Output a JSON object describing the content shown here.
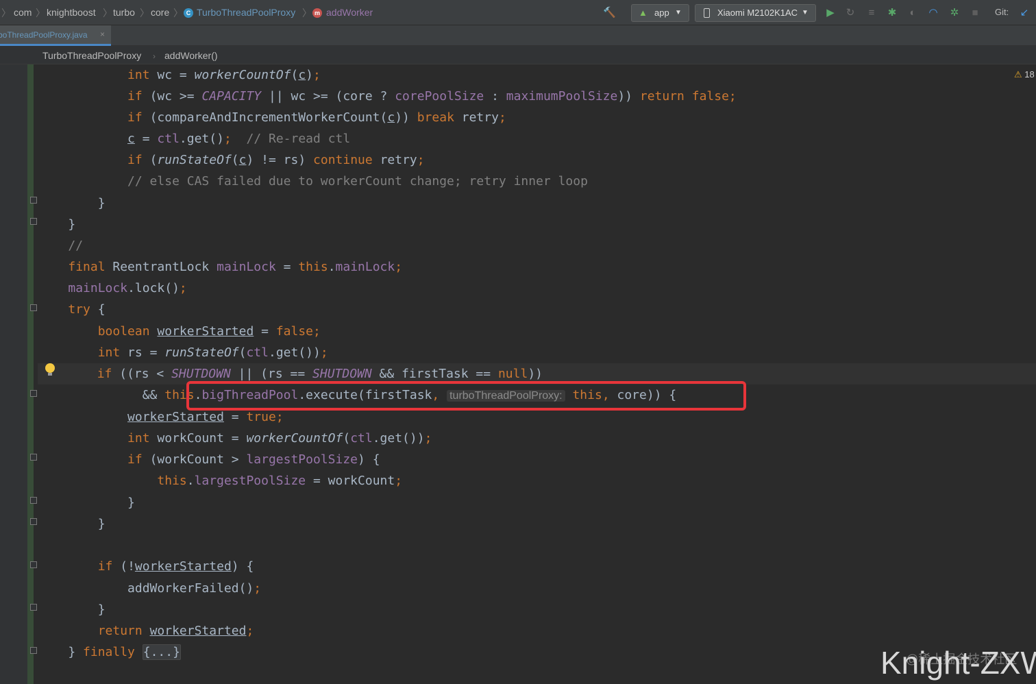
{
  "navbar": {
    "crumbs": [
      "com",
      "knightboost",
      "turbo",
      "core",
      "TurboThreadPoolProxy",
      "addWorker"
    ],
    "run_config": "app",
    "device": "Xiaomi M2102K1AC",
    "git_label": "Git:"
  },
  "tab": {
    "file_name": "boThreadPoolProxy.java",
    "close": "×"
  },
  "breadcrumb": {
    "class_name": "TurboThreadPoolProxy",
    "method_name": "addWorker()"
  },
  "editor": {
    "warning_count": "18",
    "lines": [
      "            int wc = workerCountOf(c);",
      "            if (wc >= CAPACITY || wc >= (core ? corePoolSize : maximumPoolSize)) return false;",
      "            if (compareAndIncrementWorkerCount(c)) break retry;",
      "            c = ctl.get();  // Re-read ctl",
      "            if (runStateOf(c) != rs) continue retry;",
      "            // else CAS failed due to workerCount change; retry inner loop",
      "        }",
      "    }",
      "    //",
      "    final ReentrantLock mainLock = this.mainLock;",
      "    mainLock.lock();",
      "    try {",
      "        boolean workerStarted = false;",
      "        int rs = runStateOf(ctl.get());",
      "        if ((rs < SHUTDOWN || (rs == SHUTDOWN && firstTask == null))",
      "              && this.bigThreadPool.execute(firstTask, turboThreadPoolProxy: this, core)) {",
      "            workerStarted = true;",
      "            int workCount = workerCountOf(ctl.get());",
      "            if (workCount > largestPoolSize) {",
      "                this.largestPoolSize = workCount;",
      "            }",
      "        }",
      "",
      "        if (!workerStarted) {",
      "            addWorkerFailed();",
      "        }",
      "        return workerStarted;",
      "    } finally {...}"
    ],
    "param_hint": "turboThreadPoolProxy:"
  },
  "watermark": {
    "text": "Knight-ZXW",
    "sub": "@稀土掘金技术社区"
  },
  "colors": {
    "background": "#2b2b2b",
    "keyword": "#cc7832",
    "field": "#9876aa",
    "comment": "#808080",
    "text": "#a9b7c6",
    "highlight_box": "#e8353a"
  }
}
